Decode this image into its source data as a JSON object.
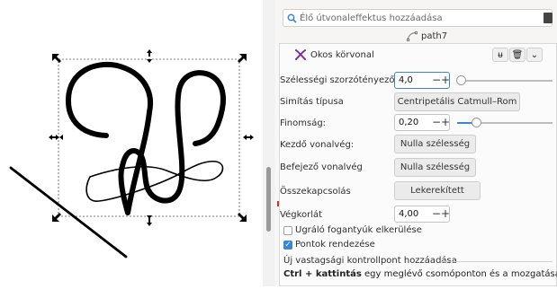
{
  "search": {
    "placeholder": "Élő útvonaleffektus hozzáadása"
  },
  "path_label": "path7",
  "effect": {
    "name": "Okos körvonal",
    "rows": [
      {
        "label": "Szélességi szorzótényező",
        "value": "4,0",
        "slider_value": 4.0,
        "slider_min": 0,
        "slider_max": 100
      },
      {
        "label": "Simítás típusa",
        "button": "Centripetális Catmull–Rom"
      },
      {
        "label": "Finomság:",
        "value": "0,20",
        "slider_value": 0.2,
        "slider_min": 0,
        "slider_max": 1
      },
      {
        "label": "Kezdő vonalvég:",
        "button": "Nulla szélesség"
      },
      {
        "label": "Befejező vonalvég",
        "button": "Nulla szélesség"
      },
      {
        "label": "Összekapcsolás",
        "button": "Lekerekített"
      },
      {
        "label": "Végkorlát",
        "value": "4,00"
      }
    ],
    "checkboxes": [
      {
        "label": "Ugráló fogantyúk elkerülése",
        "checked": false
      },
      {
        "label": "Pontok rendezése",
        "checked": true
      }
    ],
    "section_title": "Új vastagsági kontrollpont hozzáadása",
    "hint_bold": "Ctrl + kattintás",
    "hint_rest": " egy meglévő csomóponton és a mozgatása"
  },
  "colors": {
    "accent": "#3b84d6",
    "effect_icon": "#7b2d9e"
  }
}
